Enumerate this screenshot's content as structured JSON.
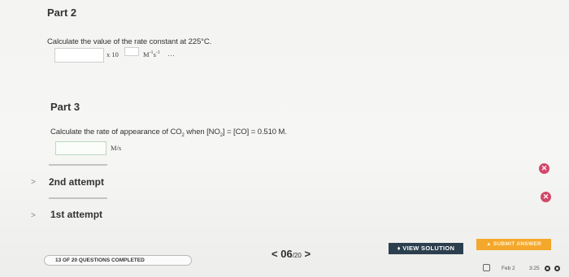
{
  "part2": {
    "title": "Part 2",
    "question": "Calculate the value of the rate constant at 225°C.",
    "times_label": "x 10",
    "units_main": "M",
    "units_exp1": "-1",
    "units_s": "s",
    "units_exp2": "-1",
    "more_glyph": "…"
  },
  "part3": {
    "title": "Part 3",
    "q_prefix": "Calculate the rate of appearance of CO",
    "q_sub1": "2",
    "q_mid1": " when [NO",
    "q_sub2": "2",
    "q_mid2": "] = [CO] = 0.510 M.",
    "units": "M/s"
  },
  "attempts": [
    {
      "label": "2nd attempt",
      "status_icon": "error-icon",
      "chevron": ">"
    },
    {
      "label": "1st attempt",
      "status_icon": "error-icon",
      "chevron": ">"
    }
  ],
  "footer": {
    "progress_text": "13 OF 20 QUESTIONS COMPLETED",
    "pager_prev": "<",
    "pager_current": "06",
    "pager_total": "/20",
    "pager_next": ">",
    "view_solution": "VIEW SOLUTION",
    "submit_answer": "SUBMIT ANSWER"
  },
  "taskbar": {
    "date": "Feb 2",
    "time": "3:25"
  },
  "colors": {
    "error": "#d2476a",
    "view_button": "#2c3f4f",
    "submit_button": "#f4a82b"
  }
}
